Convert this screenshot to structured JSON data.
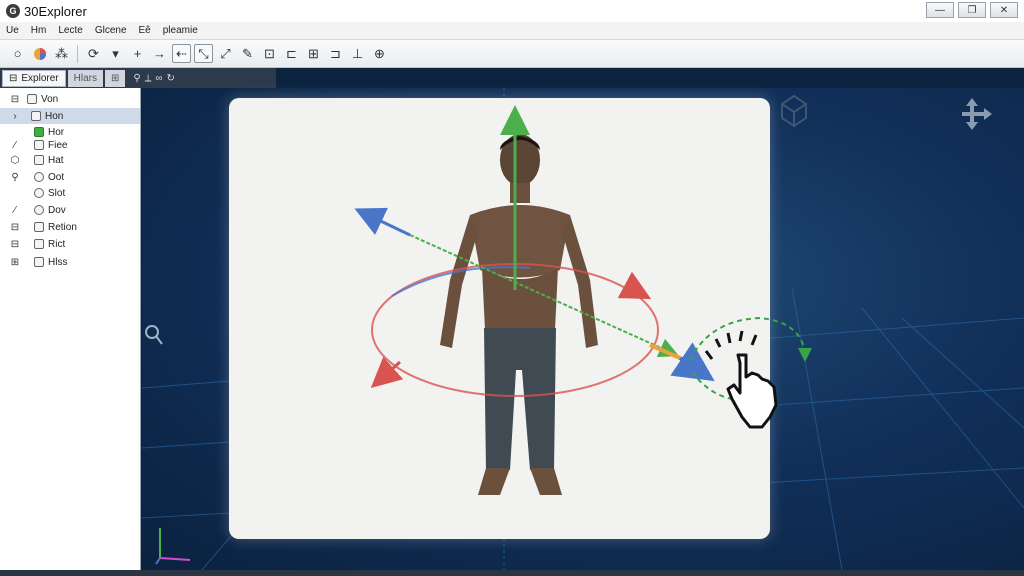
{
  "window": {
    "app_icon": "G",
    "title": "30Explorer",
    "controls": [
      "—",
      "❐",
      "✕"
    ]
  },
  "menu": {
    "items": [
      "Ue",
      "Hm",
      "Lecte",
      "Glcene",
      "Eê",
      "pleamie"
    ]
  },
  "panel_tabs": [
    {
      "label": "Explorer",
      "state": "active"
    },
    {
      "label": "Hlars",
      "state": "dim"
    }
  ],
  "tree": {
    "items": [
      {
        "label": "Von",
        "icon": "grid-icon",
        "selected": false
      },
      {
        "label": "Hon",
        "icon": "folder-icon",
        "selected": true
      },
      {
        "label": "Hor",
        "icon": "green-box-icon",
        "selected": false
      },
      {
        "label": "Fiee",
        "icon": "box-icon",
        "selected": false
      },
      {
        "label": "Hat",
        "icon": "box-icon",
        "selected": false
      },
      {
        "label": "Oot",
        "icon": "circle-icon",
        "selected": false
      },
      {
        "label": "Slot",
        "icon": "circle-icon",
        "selected": false
      },
      {
        "label": "Dov",
        "icon": "box-icon",
        "selected": false
      },
      {
        "label": "Retion",
        "icon": "box-icon",
        "selected": false
      },
      {
        "label": "Rict",
        "icon": "box-icon",
        "selected": false
      },
      {
        "label": "Hlss",
        "icon": "grid-icon",
        "selected": false
      }
    ]
  },
  "colors": {
    "x_axis": "#d9534f",
    "y_axis": "#4cae4c",
    "z_axis": "#4a76c9",
    "viewport_bg": "#11305a",
    "rotate_hint": "#3aa24a"
  }
}
